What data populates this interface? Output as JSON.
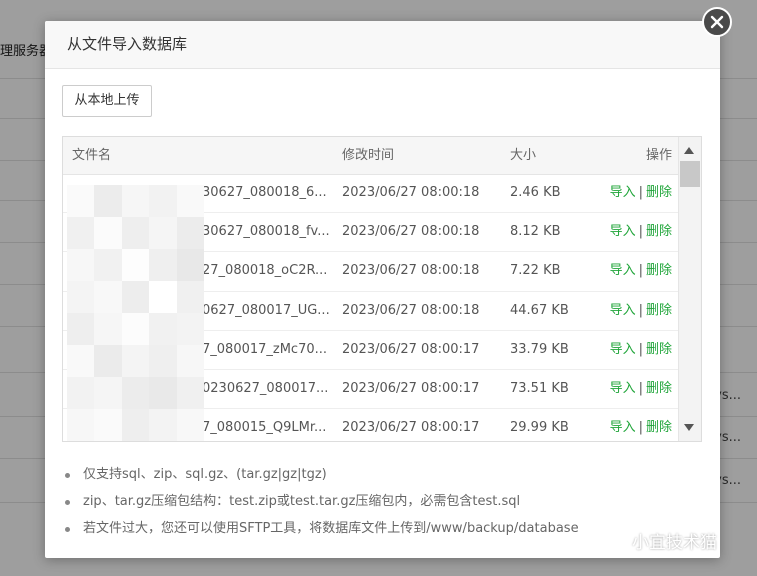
{
  "background": {
    "tab_label": "理服务器",
    "row_ellipses": [
      "ys...",
      "ys...",
      "ys..."
    ]
  },
  "dialog": {
    "title": "从文件导入数据库",
    "upload_button": "从本地上传",
    "table": {
      "headers": {
        "name": "文件名",
        "time": "修改时间",
        "size": "大小",
        "ops": "操作"
      },
      "rows": [
        {
          "name": "30627_080018_6...",
          "time": "2023/06/27 08:00:18",
          "size": "2.46 KB"
        },
        {
          "name": "30627_080018_fv...",
          "time": "2023/06/27 08:00:18",
          "size": "8.12 KB"
        },
        {
          "name": "27_080018_oC2R...",
          "time": "2023/06/27 08:00:18",
          "size": "7.22 KB"
        },
        {
          "name": "0627_080017_UG...",
          "time": "2023/06/27 08:00:18",
          "size": "44.67 KB"
        },
        {
          "name": "7_080017_zMc70...",
          "time": "2023/06/27 08:00:17",
          "size": "33.79 KB"
        },
        {
          "name": "0230627_080017...",
          "time": "2023/06/27 08:00:17",
          "size": "73.51 KB"
        },
        {
          "name": "7_080015_Q9LMr...",
          "time": "2023/06/27 08:00:17",
          "size": "29.99 KB"
        }
      ],
      "op_import": "导入",
      "op_separator": "|",
      "op_delete": "删除"
    },
    "notes": [
      "仅支持sql、zip、sql.gz、(tar.gz|gz|tgz)",
      "zip、tar.gz压缩包结构：test.zip或test.tar.gz压缩包内，必需包含test.sql",
      "若文件过大，您还可以使用SFTP工具，将数据库文件上传到/www/backup/database"
    ]
  },
  "watermark": {
    "text": "小宜技术猫"
  },
  "colors": {
    "link_green": "#20a53a",
    "close_bg": "#4a4a4a"
  }
}
